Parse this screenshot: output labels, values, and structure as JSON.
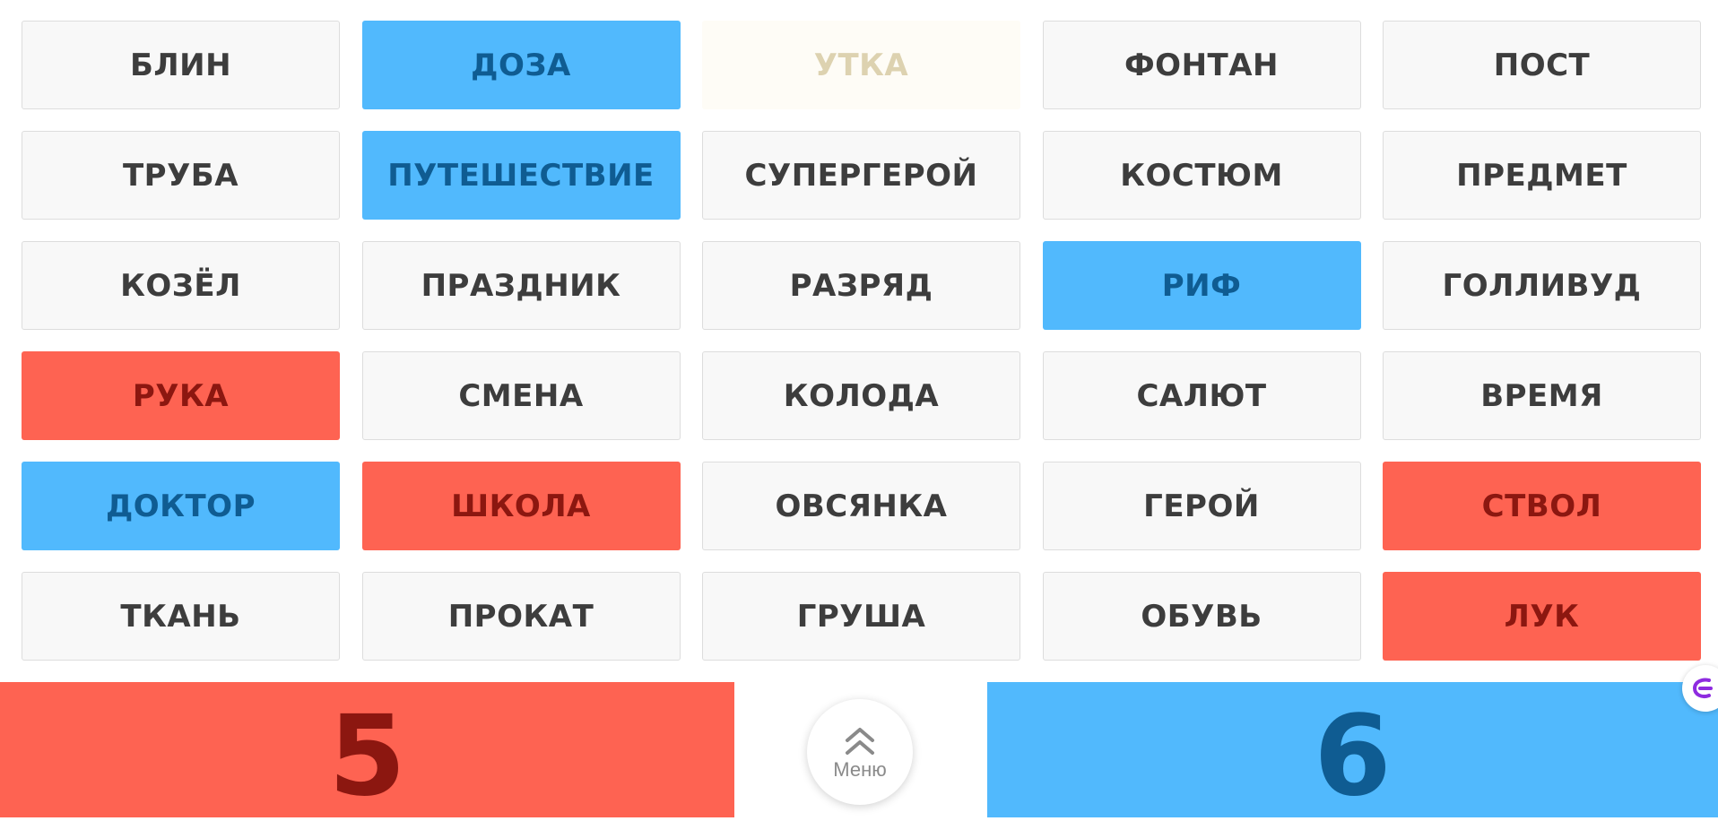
{
  "board": {
    "cards": [
      {
        "word": "БЛИН",
        "team": "neutral"
      },
      {
        "word": "ДОЗА",
        "team": "blue"
      },
      {
        "word": "УТКА",
        "team": "faded"
      },
      {
        "word": "ФОНТАН",
        "team": "neutral"
      },
      {
        "word": "ПОСТ",
        "team": "neutral"
      },
      {
        "word": "ТРУБА",
        "team": "neutral"
      },
      {
        "word": "ПУТЕШЕСТВИЕ",
        "team": "blue"
      },
      {
        "word": "СУПЕРГЕРОЙ",
        "team": "neutral"
      },
      {
        "word": "КОСТЮМ",
        "team": "neutral"
      },
      {
        "word": "ПРЕДМЕТ",
        "team": "neutral"
      },
      {
        "word": "КОЗЁЛ",
        "team": "neutral"
      },
      {
        "word": "ПРАЗДНИК",
        "team": "neutral"
      },
      {
        "word": "РАЗРЯД",
        "team": "neutral"
      },
      {
        "word": "РИФ",
        "team": "blue"
      },
      {
        "word": "ГОЛЛИВУД",
        "team": "neutral"
      },
      {
        "word": "РУКА",
        "team": "red"
      },
      {
        "word": "СМЕНА",
        "team": "neutral"
      },
      {
        "word": "КОЛОДА",
        "team": "neutral"
      },
      {
        "word": "САЛЮТ",
        "team": "neutral"
      },
      {
        "word": "ВРЕМЯ",
        "team": "neutral"
      },
      {
        "word": "ДОКТОР",
        "team": "blue"
      },
      {
        "word": "ШКОЛА",
        "team": "red"
      },
      {
        "word": "ОВСЯНКА",
        "team": "neutral"
      },
      {
        "word": "ГЕРОЙ",
        "team": "neutral"
      },
      {
        "word": "СТВОЛ",
        "team": "red"
      },
      {
        "word": "ТКАНЬ",
        "team": "neutral"
      },
      {
        "word": "ПРОКАТ",
        "team": "neutral"
      },
      {
        "word": "ГРУША",
        "team": "neutral"
      },
      {
        "word": "ОБУВЬ",
        "team": "neutral"
      },
      {
        "word": "ЛУК",
        "team": "red"
      }
    ]
  },
  "scores": {
    "red": "5",
    "blue": "6"
  },
  "menu": {
    "label": "Меню",
    "icon": "double-chevron-up-icon"
  },
  "colors": {
    "red": "#fe6352",
    "blue": "#51b9fd",
    "neutral": "#f8f8f8"
  }
}
